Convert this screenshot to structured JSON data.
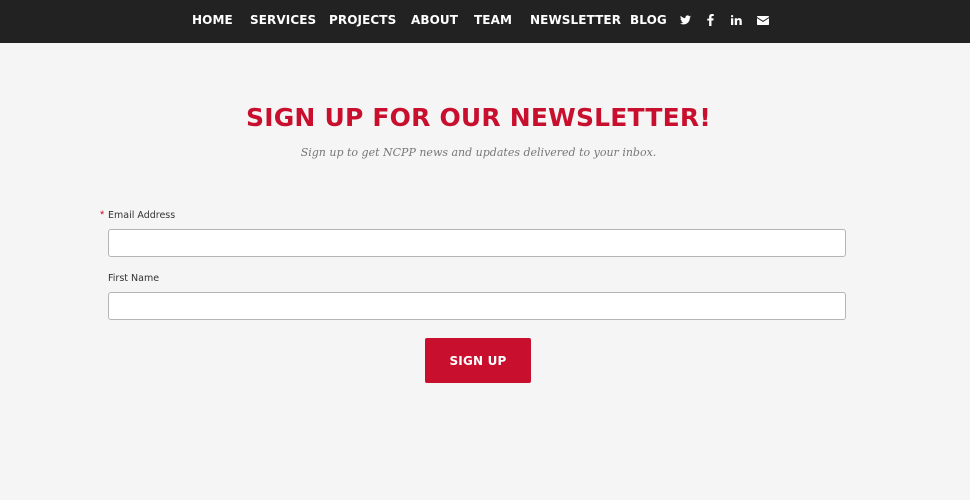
{
  "nav": {
    "links": [
      "HOME",
      "SERVICES",
      "PROJECTS",
      "ABOUT",
      "TEAM",
      "NEWSLETTER",
      "BLOG"
    ],
    "social_icons": [
      "twitter-icon",
      "facebook-icon",
      "linkedin-icon",
      "email-icon"
    ]
  },
  "signup": {
    "title": "SIGN UP FOR OUR NEWSLETTER!",
    "subtitle": "Sign up to get NCPP news and updates delivered to your inbox.",
    "required_mark": "*",
    "email_label": "Email Address",
    "email_value": "",
    "first_name_label": "First Name",
    "first_name_value": "",
    "submit_label": "SIGN UP"
  },
  "colors": {
    "nav_background": "#222222",
    "accent_red": "#c8102e",
    "page_background": "#f5f5f5"
  }
}
